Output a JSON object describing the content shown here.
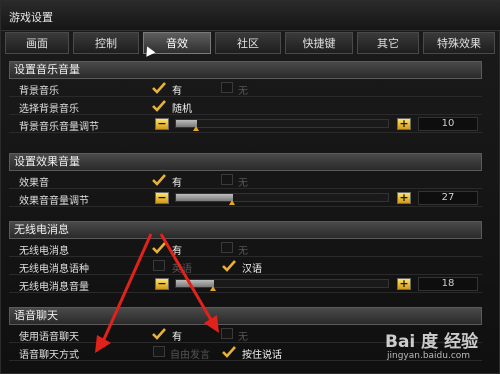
{
  "window": {
    "title": "游戏设置"
  },
  "tabs": [
    {
      "label": "画面",
      "active": false
    },
    {
      "label": "控制",
      "active": false
    },
    {
      "label": "音效",
      "active": true
    },
    {
      "label": "社区",
      "active": false
    },
    {
      "label": "快捷键",
      "active": false
    },
    {
      "label": "其它",
      "active": false
    },
    {
      "label": "特殊效果",
      "active": false
    }
  ],
  "music": {
    "header": "设置音乐音量",
    "bgm_label": "背景音乐",
    "bgm_yes": "有",
    "bgm_no": "无",
    "choose_label": "选择背景音乐",
    "choose_value": "随机",
    "volume_label": "背景音乐音量调节",
    "volume_value": "10",
    "volume_fraction": 0.1
  },
  "effects": {
    "header": "设置效果音量",
    "sfx_label": "效果音",
    "sfx_yes": "有",
    "sfx_no": "无",
    "volume_label": "效果音音量调节",
    "volume_value": "27",
    "volume_fraction": 0.27
  },
  "radio": {
    "header": "无线电消息",
    "msg_label": "无线电消息",
    "msg_yes": "有",
    "msg_no": "无",
    "lang_label": "无线电消息语种",
    "lang_opt1": "英语",
    "lang_opt2": "汉语",
    "volume_label": "无线电消息音量",
    "volume_value": "18",
    "volume_fraction": 0.18
  },
  "voice": {
    "header": "语音聊天",
    "use_label": "使用语音聊天",
    "use_yes": "有",
    "use_no": "无",
    "mode_label": "语音聊天方式",
    "mode_opt1": "自由发言",
    "mode_opt2": "按住说话"
  },
  "controls": {
    "minus": "−",
    "plus": "+"
  },
  "watermark": {
    "brand": "Bai 度 经验",
    "url": "jingyan.baidu.com"
  },
  "colors": {
    "accent": "#e8b23a",
    "arrow": "#e0221b"
  }
}
